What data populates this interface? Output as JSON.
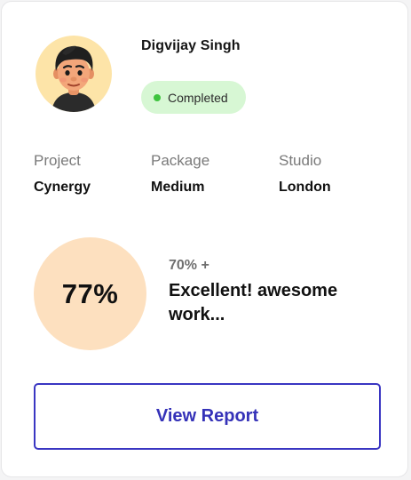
{
  "user": {
    "name": "Digvijay Singh",
    "avatar_icon": "person-memoji-avatar",
    "avatar_bg_color": "#fde4a8"
  },
  "status": {
    "label": "Completed",
    "badge_color": "#d7f7d4",
    "dot_color": "#3ec43e"
  },
  "details": [
    {
      "label": "Project",
      "value": "Cynergy"
    },
    {
      "label": "Package",
      "value": "Medium"
    },
    {
      "label": "Studio",
      "value": "London"
    }
  ],
  "score": {
    "value": "77%",
    "threshold": "70% +",
    "message": "Excellent! awesome work...",
    "circle_color": "#fde0bf"
  },
  "actions": {
    "view_report_label": "View Report",
    "accent_color": "#3532b8"
  }
}
